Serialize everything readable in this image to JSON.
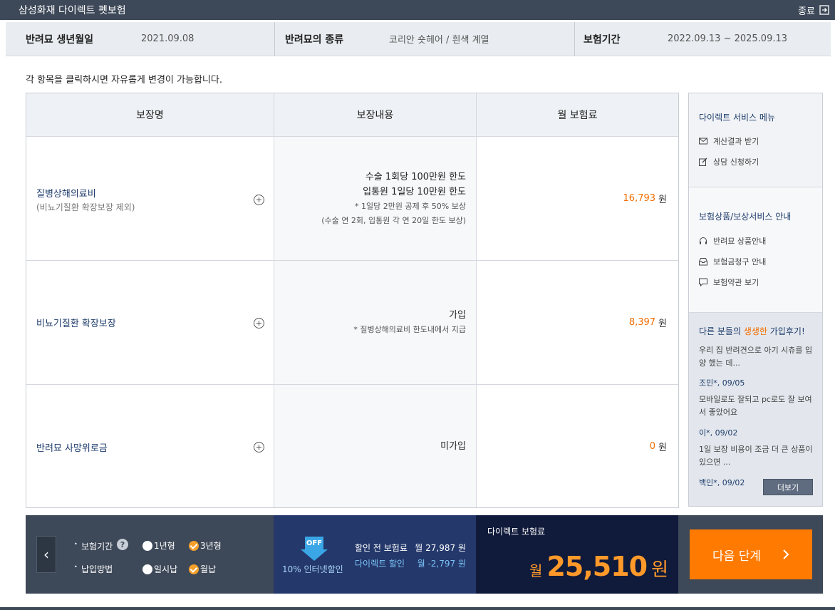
{
  "window": {
    "title": "삼성화재 다이렉트 펫보험",
    "close_label": "종료"
  },
  "info": {
    "birth_label": "반려묘 생년월일",
    "birth_value": "2021.09.08",
    "breed_label": "반려묘의 종류",
    "breed_value": "코리안 숏헤어 / 흰색 계열",
    "period_label": "보험기간",
    "period_value": "2022.09.13 ~ 2025.09.13"
  },
  "notice": "각 항목을 클릭하시면 자유롭게 변경이 가능합니다.",
  "table": {
    "headers": [
      "보장명",
      "보장내용",
      "월 보험료"
    ],
    "rows": [
      {
        "name": "질병상해의료비",
        "sub": "(비뇨기질환 확장보장 제외)",
        "lines": [
          "수술 1회당 100만원 한도",
          "입통원 1일당 10만원 한도"
        ],
        "notes": [
          "* 1일당 2만원 공제 후 50% 보상",
          "(수술 연 2회, 입통원 각 연 20일 한도 보상)"
        ],
        "amount": "16,793",
        "unit": "원"
      },
      {
        "name": "비뇨기질환 확장보장",
        "sub": "",
        "lines": [
          "가입"
        ],
        "notes": [
          "* 질병상해의료비 한도내에서 지급"
        ],
        "amount": "8,397",
        "unit": "원"
      },
      {
        "name": "반려묘 사망위로금",
        "sub": "",
        "lines": [
          "미가입"
        ],
        "notes": [],
        "amount": "0",
        "unit": "원"
      }
    ]
  },
  "side": {
    "section1": {
      "title": "다이렉트 서비스 메뉴",
      "items": [
        {
          "label": "계산결과 받기",
          "icon": "mail-icon"
        },
        {
          "label": "상담 신청하기",
          "icon": "edit-icon"
        }
      ]
    },
    "section2": {
      "title": "보험상품/보상서비스 안내",
      "items": [
        {
          "label": "반려묘 상품안내",
          "icon": "headset-icon"
        },
        {
          "label": "보험금청구 안내",
          "icon": "inbox-icon"
        },
        {
          "label": "보험약관 보기",
          "icon": "chat-icon"
        }
      ]
    },
    "section3": {
      "title_pre": "다른 분들의 ",
      "title_hl": "생생한",
      "title_post": " 가입후기!",
      "reviews": [
        {
          "text": "우리 집 반려견으로 아기 시츄를 입양 했는 데...",
          "author": "조민*, 09/05"
        },
        {
          "text": "모바일로도 잘되고 pc로도 잘 보여서 좋았어요",
          "author": "이*, 09/02"
        },
        {
          "text": "1일 보장 비용이 조금 더 큰 상품이 있으면 ...",
          "author": "백인*, 09/02"
        }
      ],
      "more_label": "더보기"
    }
  },
  "bottom": {
    "period_label": "보험기간",
    "period_opts": [
      {
        "label": "1년형",
        "checked": false
      },
      {
        "label": "3년형",
        "checked": true
      }
    ],
    "payment_label": "납입방법",
    "payment_opts": [
      {
        "label": "일시납",
        "checked": false
      },
      {
        "label": "월납",
        "checked": true
      }
    ],
    "off_badge": "OFF",
    "discount_text": "10% 인터넷할인",
    "before_label": "할인 전 보험료",
    "before_value": "월 27,987 원",
    "direct_label": "다이렉트 할인",
    "direct_value": "월 -2,797 원",
    "price_title": "다이렉트 보험료",
    "price_prefix": "월",
    "price_value": "25,510",
    "price_unit": "원",
    "next_label": "다음 단계"
  },
  "colors": {
    "accent": "#ff7a00",
    "navy": "#24386b",
    "dark": "#3d4858",
    "text_blue": "#1d3b6b"
  }
}
